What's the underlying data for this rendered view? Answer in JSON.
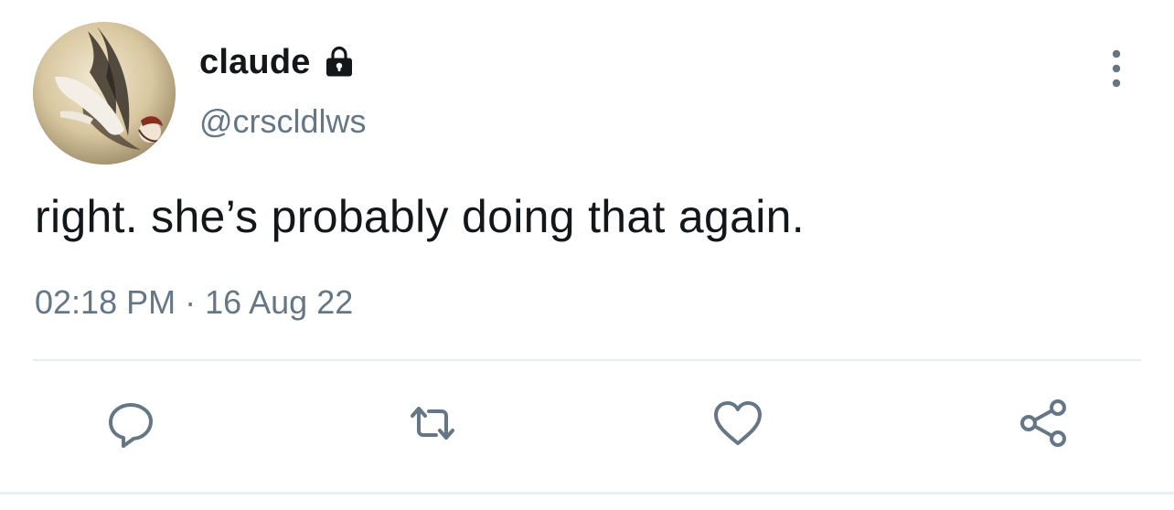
{
  "user": {
    "display_name": "claude",
    "handle": "@crscldlws",
    "protected_icon": "lock-icon",
    "avatar_icon": "avatar"
  },
  "tweet": {
    "text": "right. she’s probably doing that again.",
    "time": "02:18 PM",
    "separator": " · ",
    "date": "16 Aug 22"
  },
  "actions": {
    "reply_icon": "reply-icon",
    "retweet_icon": "retweet-icon",
    "like_icon": "heart-icon",
    "share_icon": "share-icon"
  },
  "menu": {
    "more_icon": "more-vertical-icon"
  },
  "colors": {
    "text": "#14171a",
    "secondary": "#657786",
    "divider": "#e6ecf0"
  }
}
